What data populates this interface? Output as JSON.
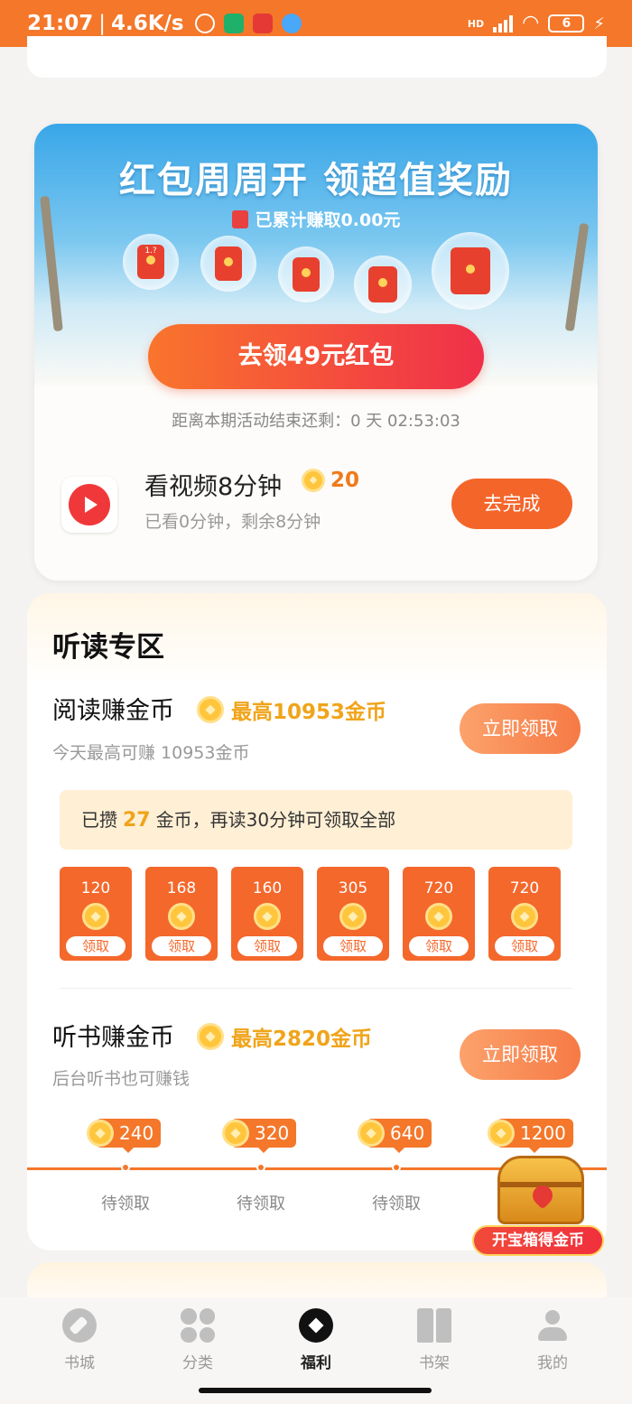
{
  "status_bar": {
    "time": "21:07",
    "separator": "|",
    "net_speed": "4.6K/s",
    "battery": "6",
    "network": "HD"
  },
  "red_packet": {
    "title": "红包周周开 领超值奖励",
    "earned_text": "已累计赚取0.00元",
    "first_bubble_label": "1.?",
    "button_label": "去领49元红包",
    "countdown_text": "距离本期活动结束还剩：0 天 02:53:03",
    "task": {
      "title": "看视频8分钟",
      "reward": "20",
      "subtitle": "已看0分钟，剩余8分钟",
      "button_label": "去完成"
    }
  },
  "zone": {
    "title": "听读专区",
    "read": {
      "title": "阅读赚金币",
      "max_label": "最高10953金币",
      "subtitle": "今天最高可赚 10953金币",
      "button_label": "立即领取",
      "progress_prefix": "已攒",
      "progress_coins": "27",
      "progress_suffix": "金币，再读30分钟可领取全部",
      "packets": [
        {
          "value": "120",
          "label": "领取"
        },
        {
          "value": "168",
          "label": "领取"
        },
        {
          "value": "160",
          "label": "领取"
        },
        {
          "value": "305",
          "label": "领取"
        },
        {
          "value": "720",
          "label": "领取"
        },
        {
          "value": "720",
          "label": "领取"
        }
      ]
    },
    "listen": {
      "title": "听书赚金币",
      "max_label": "最高2820金币",
      "subtitle": "后台听书也可赚钱",
      "button_label": "立即领取",
      "milestones": [
        {
          "value": "240",
          "status": "待领取"
        },
        {
          "value": "320",
          "status": "待领取"
        },
        {
          "value": "640",
          "status": "待领取"
        },
        {
          "value": "1200",
          "status": ""
        }
      ]
    }
  },
  "treasure": {
    "label": "开宝箱得金币"
  },
  "bottom_nav": {
    "items": [
      {
        "label": "书城",
        "icon": "compass-icon"
      },
      {
        "label": "分类",
        "icon": "category-grid-icon"
      },
      {
        "label": "福利",
        "icon": "welfare-icon",
        "active": true
      },
      {
        "label": "书架",
        "icon": "bookshelf-icon"
      },
      {
        "label": "我的",
        "icon": "profile-icon"
      }
    ]
  },
  "colors": {
    "accent": "#f4772a",
    "coin": "#ffc63d",
    "red": "#f0383a"
  }
}
